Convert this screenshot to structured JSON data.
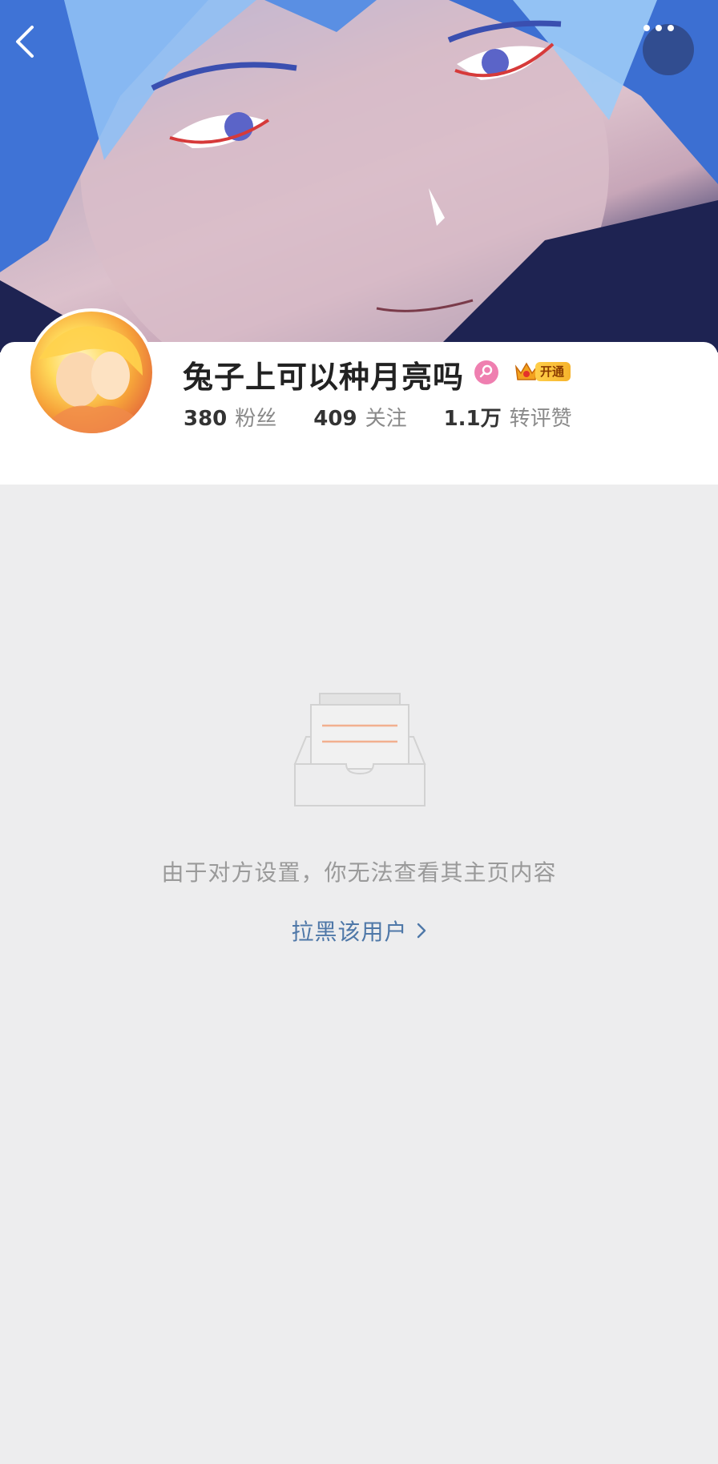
{
  "profile": {
    "username": "兔子上可以种月亮吗",
    "vip_label": "开通",
    "stats": [
      {
        "value": "380",
        "label": "粉丝"
      },
      {
        "value": "409",
        "label": "关注"
      },
      {
        "value": "1.1万",
        "label": "转评赞"
      }
    ]
  },
  "empty_state": {
    "message": "由于对方设置，你无法查看其主页内容",
    "block_link": "拉黑该用户"
  },
  "icons": {
    "back": "back-arrow-icon",
    "more": "more-dots-icon",
    "search_badge": "search-badge-icon",
    "vip": "vip-crown-icon",
    "empty": "empty-inbox-icon",
    "chevron": "chevron-right-icon"
  },
  "colors": {
    "page_background": "#ededee",
    "card_background": "#ffffff",
    "link": "#4f78a8",
    "muted_text": "#9a9a9a",
    "badge_pink": "#ef7fb0",
    "vip_gold": "#f6b32c"
  }
}
